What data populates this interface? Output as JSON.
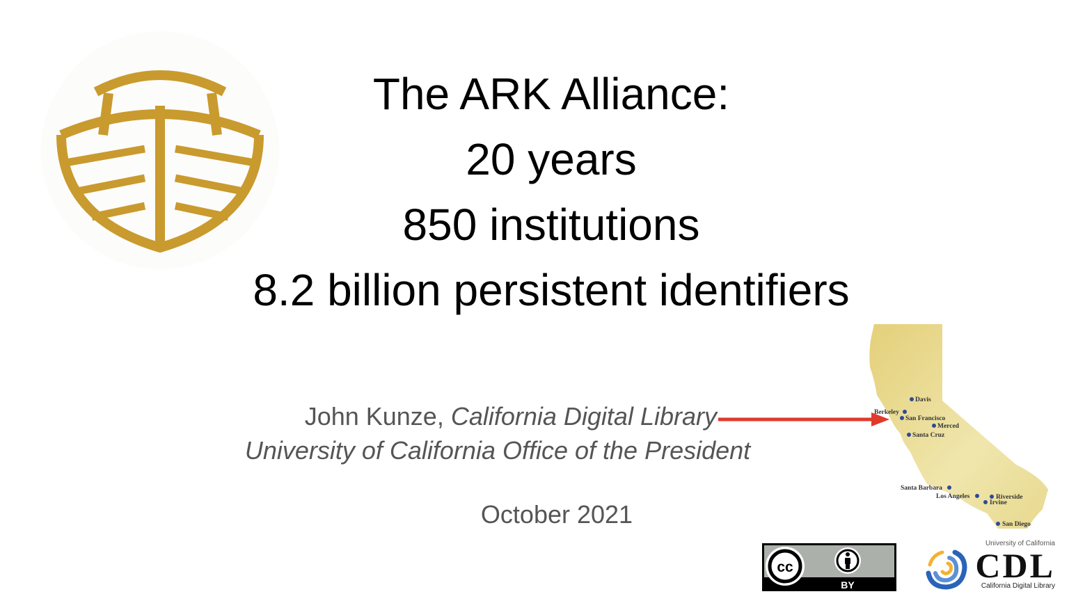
{
  "title_lines": [
    "The ARK Alliance:",
    "20 years",
    "850 institutions",
    "8.2 billion persistent identifiers"
  ],
  "author": {
    "name": "John Kunze, ",
    "org": "California Digital Library"
  },
  "office": "University of California Office of the President",
  "date": "October 2021",
  "map": {
    "cities": [
      "Davis",
      "Berkeley",
      "San Francisco",
      "Merced",
      "Santa Cruz",
      "Santa Barbara",
      "Los Angeles",
      "Riverside",
      "Irvine",
      "San Diego"
    ]
  },
  "license": {
    "cc_label": "cc",
    "by_label": "BY"
  },
  "cdl_logo": {
    "top_text": "University of California",
    "mark": "CDL",
    "bottom_text": "California Digital Library"
  },
  "colors": {
    "ark_gold": "#c99a2e",
    "arrow_red": "#e03a2c",
    "map_fill": "#ecdf9b",
    "city_dot": "#2c4a9a",
    "cdl_blue": "#2a64b8"
  },
  "icons": [
    "ark-logo-icon",
    "arrow-icon",
    "california-map",
    "cc-icon",
    "person-icon",
    "cdl-swirl-icon"
  ]
}
